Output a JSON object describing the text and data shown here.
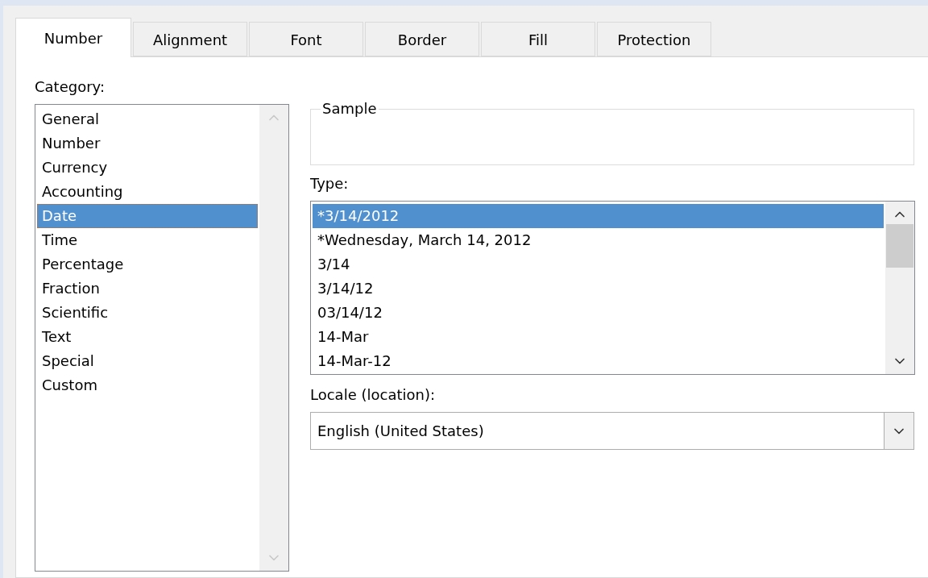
{
  "tabs": [
    {
      "label": "Number",
      "selected": true
    },
    {
      "label": "Alignment",
      "selected": false
    },
    {
      "label": "Font",
      "selected": false
    },
    {
      "label": "Border",
      "selected": false
    },
    {
      "label": "Fill",
      "selected": false
    },
    {
      "label": "Protection",
      "selected": false
    }
  ],
  "category": {
    "label": "Category:",
    "items": [
      {
        "label": "General",
        "selected": false
      },
      {
        "label": "Number",
        "selected": false
      },
      {
        "label": "Currency",
        "selected": false
      },
      {
        "label": "Accounting",
        "selected": false
      },
      {
        "label": "Date",
        "selected": true
      },
      {
        "label": "Time",
        "selected": false
      },
      {
        "label": "Percentage",
        "selected": false
      },
      {
        "label": "Fraction",
        "selected": false
      },
      {
        "label": "Scientific",
        "selected": false
      },
      {
        "label": "Text",
        "selected": false
      },
      {
        "label": "Special",
        "selected": false
      },
      {
        "label": "Custom",
        "selected": false
      }
    ]
  },
  "sample": {
    "label": "Sample"
  },
  "type": {
    "label": "Type:",
    "items": [
      {
        "label": "*3/14/2012",
        "selected": true
      },
      {
        "label": "*Wednesday, March 14, 2012",
        "selected": false
      },
      {
        "label": "3/14",
        "selected": false
      },
      {
        "label": "3/14/12",
        "selected": false
      },
      {
        "label": "03/14/12",
        "selected": false
      },
      {
        "label": "14-Mar",
        "selected": false
      },
      {
        "label": "14-Mar-12",
        "selected": false
      }
    ]
  },
  "locale": {
    "label": "Locale (location):",
    "value": "English (United States)"
  }
}
